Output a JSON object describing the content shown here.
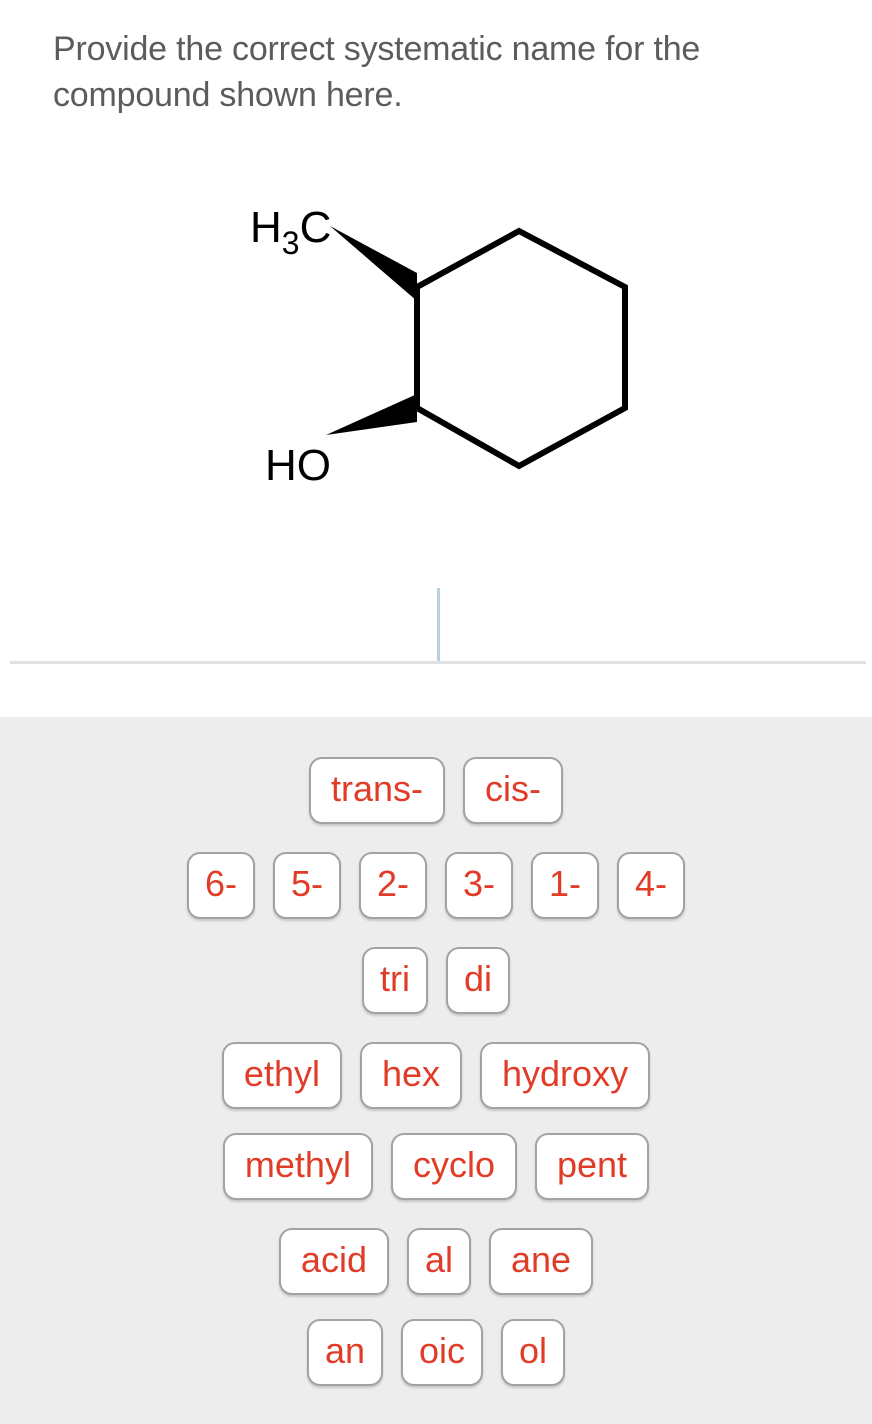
{
  "question": {
    "prompt": "Provide the correct systematic name for the compound shown here."
  },
  "structure": {
    "methyl_label": "H",
    "methyl_sub": "3",
    "methyl_label_tail": "C",
    "hydroxyl_label": "HO",
    "description": "cyclohexane ring with methyl and hydroxyl on bold wedge bonds"
  },
  "answer_field": {
    "value": "",
    "caret_color": "#b9d0e0",
    "underline_color": "#e2e2e2"
  },
  "tray": {
    "background": "#ededed",
    "tile_text_color": "#e03c28",
    "tile_border_color": "#a3a3a3",
    "rows": [
      {
        "name": "stereo",
        "tiles": [
          "trans-",
          "cis-"
        ]
      },
      {
        "name": "locants",
        "tiles": [
          "6-",
          "5-",
          "2-",
          "3-",
          "1-",
          "4-"
        ]
      },
      {
        "name": "multipliers",
        "tiles": [
          "tri",
          "di"
        ]
      },
      {
        "name": "substituents-a",
        "tiles": [
          "ethyl",
          "hex",
          "hydroxy"
        ]
      },
      {
        "name": "substituents-b",
        "tiles": [
          "methyl",
          "cyclo",
          "pent"
        ]
      },
      {
        "name": "suffixes-a",
        "tiles": [
          "acid",
          "al",
          "ane"
        ]
      },
      {
        "name": "suffixes-b",
        "tiles": [
          "an",
          "oic",
          "ol"
        ]
      }
    ]
  }
}
